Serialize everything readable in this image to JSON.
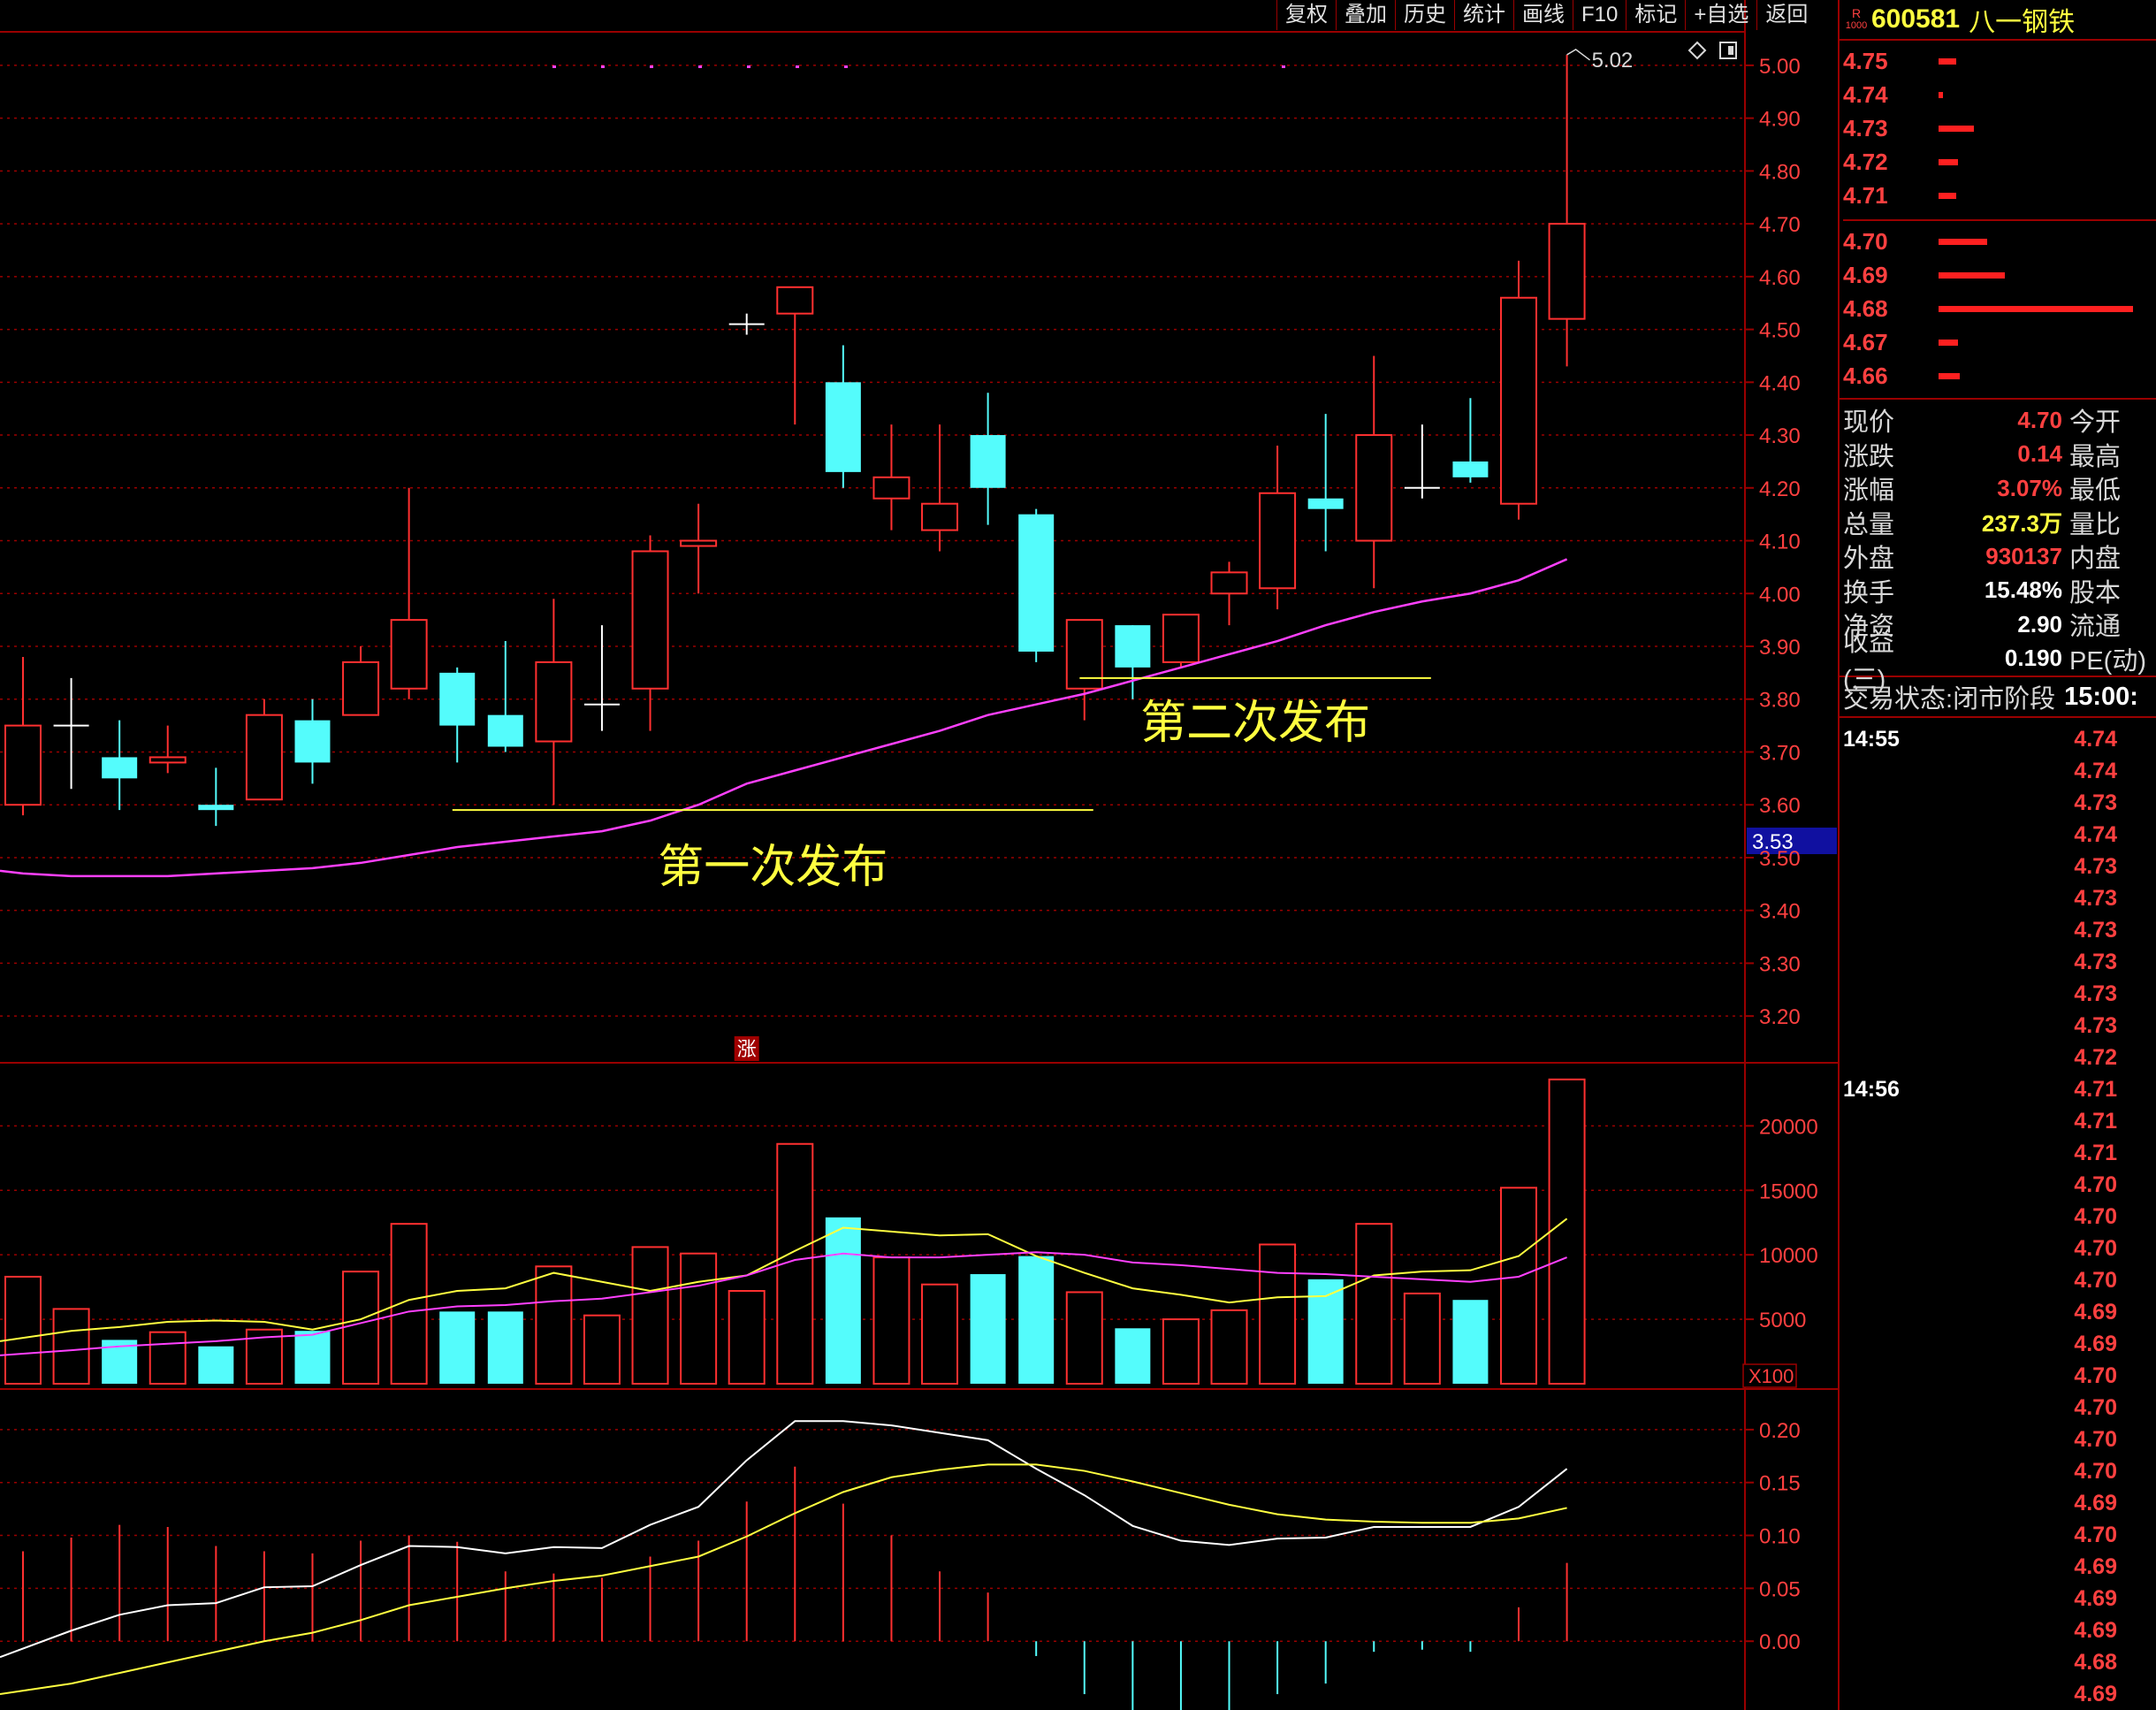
{
  "toolbar": {
    "items": [
      "复权",
      "叠加",
      "历史",
      "统计",
      "画线",
      "F10",
      "标记",
      "+自选",
      "返回"
    ]
  },
  "stock": {
    "badge_top": "R",
    "badge_bottom": "1000",
    "code": "600581",
    "name": "八一钢铁"
  },
  "orderbook": {
    "ask": [
      {
        "price": "4.75",
        "size": 20
      },
      {
        "price": "4.74",
        "size": 5
      },
      {
        "price": "4.73",
        "size": 40
      },
      {
        "price": "4.72",
        "size": 22
      },
      {
        "price": "4.71",
        "size": 20
      }
    ],
    "bid": [
      {
        "price": "4.70",
        "size": 55
      },
      {
        "price": "4.69",
        "size": 75
      },
      {
        "price": "4.68",
        "size": 220
      },
      {
        "price": "4.67",
        "size": 22
      },
      {
        "price": "4.66",
        "size": 24
      }
    ]
  },
  "quote": [
    {
      "label": "现价",
      "value": "4.70",
      "label2": "今开",
      "color": "red"
    },
    {
      "label": "涨跌",
      "value": "0.14",
      "label2": "最高",
      "color": "red"
    },
    {
      "label": "涨幅",
      "value": "3.07%",
      "label2": "最低",
      "color": "red"
    },
    {
      "label": "总量",
      "value": "237.3万",
      "label2": "量比",
      "color": "yel"
    },
    {
      "label": "外盘",
      "value": "930137",
      "label2": "内盘",
      "color": "red"
    },
    {
      "label": "换手",
      "value": "15.48%",
      "label2": "股本",
      "color": "wht"
    },
    {
      "label": "净资",
      "value": "2.90",
      "label2": "流通",
      "color": "wht"
    },
    {
      "label": "收益(三)",
      "value": "0.190",
      "label2": "PE(动)",
      "color": "wht"
    }
  ],
  "status": {
    "label": "交易状态:",
    "value": "闭市阶段",
    "time": "15:00:"
  },
  "ticks": [
    {
      "time": "14:55",
      "price": "4.74"
    },
    {
      "time": "",
      "price": "4.74"
    },
    {
      "time": "",
      "price": "4.73"
    },
    {
      "time": "",
      "price": "4.74"
    },
    {
      "time": "",
      "price": "4.73"
    },
    {
      "time": "",
      "price": "4.73"
    },
    {
      "time": "",
      "price": "4.73"
    },
    {
      "time": "",
      "price": "4.73"
    },
    {
      "time": "",
      "price": "4.73"
    },
    {
      "time": "",
      "price": "4.73"
    },
    {
      "time": "",
      "price": "4.72"
    },
    {
      "time": "14:56",
      "price": "4.71"
    },
    {
      "time": "",
      "price": "4.71"
    },
    {
      "time": "",
      "price": "4.71"
    },
    {
      "time": "",
      "price": "4.70"
    },
    {
      "time": "",
      "price": "4.70"
    },
    {
      "time": "",
      "price": "4.70"
    },
    {
      "time": "",
      "price": "4.70"
    },
    {
      "time": "",
      "price": "4.69"
    },
    {
      "time": "",
      "price": "4.69"
    },
    {
      "time": "",
      "price": "4.70"
    },
    {
      "time": "",
      "price": "4.70"
    },
    {
      "time": "",
      "price": "4.70"
    },
    {
      "time": "",
      "price": "4.70"
    },
    {
      "time": "",
      "price": "4.69"
    },
    {
      "time": "",
      "price": "4.70"
    },
    {
      "time": "",
      "price": "4.69"
    },
    {
      "time": "",
      "price": "4.69"
    },
    {
      "time": "",
      "price": "4.69"
    },
    {
      "time": "",
      "price": "4.68"
    },
    {
      "time": "",
      "price": "4.69"
    }
  ],
  "colors": {
    "up": "#ff3030",
    "down": "#54fcfc",
    "ma": "#ff40ff",
    "grid": "#9a0000",
    "annotation": "#ffff40"
  },
  "chart_data": [
    {
      "type": "candlestick",
      "title": "",
      "yticks": [
        "5.00",
        "4.90",
        "4.80",
        "4.70",
        "4.60",
        "4.50",
        "4.40",
        "4.30",
        "4.20",
        "4.10",
        "4.00",
        "3.90",
        "3.80",
        "3.70",
        "3.60",
        "3.50",
        "3.40",
        "3.30",
        "3.20"
      ],
      "ylim": [
        3.14,
        5.04
      ],
      "crosshair_label": "3.53",
      "high_label": "5.02",
      "candles": [
        {
          "o": 3.6,
          "h": 3.88,
          "l": 3.58,
          "c": 3.75
        },
        {
          "o": 3.75,
          "h": 3.84,
          "l": 3.63,
          "c": 3.75
        },
        {
          "o": 3.69,
          "h": 3.76,
          "l": 3.59,
          "c": 3.65
        },
        {
          "o": 3.68,
          "h": 3.75,
          "l": 3.66,
          "c": 3.69
        },
        {
          "o": 3.6,
          "h": 3.67,
          "l": 3.56,
          "c": 3.59
        },
        {
          "o": 3.61,
          "h": 3.8,
          "l": 3.61,
          "c": 3.77
        },
        {
          "o": 3.76,
          "h": 3.8,
          "l": 3.64,
          "c": 3.68
        },
        {
          "o": 3.77,
          "h": 3.9,
          "l": 3.77,
          "c": 3.87
        },
        {
          "o": 3.82,
          "h": 4.2,
          "l": 3.8,
          "c": 3.95
        },
        {
          "o": 3.85,
          "h": 3.86,
          "l": 3.68,
          "c": 3.75
        },
        {
          "o": 3.77,
          "h": 3.91,
          "l": 3.7,
          "c": 3.71
        },
        {
          "o": 3.72,
          "h": 3.99,
          "l": 3.6,
          "c": 3.87
        },
        {
          "o": 3.79,
          "h": 3.94,
          "l": 3.74,
          "c": 3.79
        },
        {
          "o": 3.82,
          "h": 4.11,
          "l": 3.74,
          "c": 4.08
        },
        {
          "o": 4.09,
          "h": 4.17,
          "l": 4.0,
          "c": 4.1
        },
        {
          "o": 4.51,
          "h": 4.53,
          "l": 4.49,
          "c": 4.51
        },
        {
          "o": 4.53,
          "h": 4.58,
          "l": 4.32,
          "c": 4.58
        },
        {
          "o": 4.4,
          "h": 4.47,
          "l": 4.2,
          "c": 4.23
        },
        {
          "o": 4.18,
          "h": 4.32,
          "l": 4.12,
          "c": 4.22
        },
        {
          "o": 4.12,
          "h": 4.32,
          "l": 4.08,
          "c": 4.17
        },
        {
          "o": 4.3,
          "h": 4.38,
          "l": 4.13,
          "c": 4.2
        },
        {
          "o": 4.15,
          "h": 4.16,
          "l": 3.87,
          "c": 3.89
        },
        {
          "o": 3.82,
          "h": 3.95,
          "l": 3.76,
          "c": 3.95
        },
        {
          "o": 3.94,
          "h": 3.94,
          "l": 3.8,
          "c": 3.86
        },
        {
          "o": 3.87,
          "h": 3.96,
          "l": 3.86,
          "c": 3.96
        },
        {
          "o": 4.0,
          "h": 4.06,
          "l": 3.94,
          "c": 4.04
        },
        {
          "o": 4.01,
          "h": 4.28,
          "l": 3.97,
          "c": 4.19
        },
        {
          "o": 4.18,
          "h": 4.34,
          "l": 4.08,
          "c": 4.16
        },
        {
          "o": 4.1,
          "h": 4.45,
          "l": 4.01,
          "c": 4.3
        },
        {
          "o": 4.2,
          "h": 4.32,
          "l": 4.18,
          "c": 4.2
        },
        {
          "o": 4.25,
          "h": 4.37,
          "l": 4.21,
          "c": 4.22
        },
        {
          "o": 4.17,
          "h": 4.63,
          "l": 4.14,
          "c": 4.56
        },
        {
          "o": 4.52,
          "h": 5.02,
          "l": 4.43,
          "c": 4.7
        }
      ],
      "ma": [
        3.47,
        3.465,
        3.465,
        3.465,
        3.47,
        3.475,
        3.48,
        3.49,
        3.505,
        3.52,
        3.53,
        3.54,
        3.55,
        3.57,
        3.6,
        3.64,
        3.665,
        3.69,
        3.715,
        3.74,
        3.77,
        3.79,
        3.81,
        3.835,
        3.86,
        3.885,
        3.91,
        3.94,
        3.965,
        3.985,
        4.0,
        4.025,
        4.065
      ],
      "annotations": [
        {
          "text": "第一次发布",
          "level": 3.59,
          "from": 10,
          "to": 22
        },
        {
          "text": "第二次发布",
          "level": 3.84,
          "from": 23,
          "to": 29
        }
      ],
      "marker_label": "涨"
    },
    {
      "type": "bar",
      "title": "",
      "unit_label": "X100",
      "yticks": [
        "20000",
        "15000",
        "10000",
        "5000"
      ],
      "ylim": [
        0,
        24000
      ],
      "values": [
        8300,
        5800,
        3400,
        4000,
        2900,
        4200,
        4100,
        8700,
        12400,
        5600,
        5600,
        9100,
        5300,
        10600,
        10100,
        7200,
        18600,
        12900,
        9800,
        7700,
        8500,
        9900,
        7100,
        4300,
        5000,
        5700,
        10800,
        8100,
        12400,
        7000,
        6500,
        15200,
        23600
      ],
      "ma1": [
        3300,
        4100,
        4400,
        4800,
        4900,
        4800,
        4200,
        5000,
        6500,
        7200,
        7400,
        8600,
        7900,
        7200,
        7900,
        8400,
        10300,
        12100,
        11800,
        11500,
        11600,
        9900,
        8600,
        7400,
        6900,
        6300,
        6700,
        6800,
        8400,
        8700,
        8800,
        9900,
        12800
      ],
      "ma2": [
        2200,
        2600,
        2900,
        3100,
        3300,
        3600,
        3800,
        4700,
        5600,
        6000,
        6100,
        6400,
        6600,
        7100,
        7600,
        8400,
        9600,
        10100,
        9800,
        9800,
        10000,
        10200,
        10000,
        9400,
        9200,
        8900,
        8600,
        8500,
        8300,
        8100,
        7900,
        8300,
        9800
      ]
    },
    {
      "type": "macd",
      "title": "",
      "yticks": [
        "0.20",
        "0.15",
        "0.10",
        "0.05",
        "0.00"
      ],
      "ylim": [
        -0.065,
        0.235
      ],
      "dif": [
        -0.015,
        0.01,
        0.025,
        0.034,
        0.036,
        0.051,
        0.052,
        0.072,
        0.09,
        0.089,
        0.083,
        0.089,
        0.088,
        0.11,
        0.127,
        0.171,
        0.208,
        0.208,
        0.204,
        0.197,
        0.19,
        0.163,
        0.138,
        0.109,
        0.095,
        0.091,
        0.097,
        0.098,
        0.108,
        0.108,
        0.108,
        0.127,
        0.163
      ],
      "dea": [
        -0.05,
        -0.04,
        -0.03,
        -0.02,
        -0.01,
        0.0,
        0.008,
        0.02,
        0.034,
        0.042,
        0.05,
        0.057,
        0.062,
        0.071,
        0.08,
        0.099,
        0.121,
        0.141,
        0.155,
        0.162,
        0.167,
        0.167,
        0.161,
        0.151,
        0.14,
        0.129,
        0.12,
        0.115,
        0.113,
        0.112,
        0.112,
        0.116,
        0.126
      ],
      "hist": [
        0.085,
        0.098,
        0.11,
        0.108,
        0.09,
        0.085,
        0.083,
        0.095,
        0.1,
        0.094,
        0.066,
        0.064,
        0.06,
        0.08,
        0.095,
        0.132,
        0.165,
        0.13,
        0.1,
        0.066,
        0.046,
        -0.014,
        -0.05,
        -0.08,
        -0.09,
        -0.076,
        -0.05,
        -0.04,
        -0.01,
        -0.008,
        -0.01,
        0.032,
        0.074
      ]
    }
  ]
}
